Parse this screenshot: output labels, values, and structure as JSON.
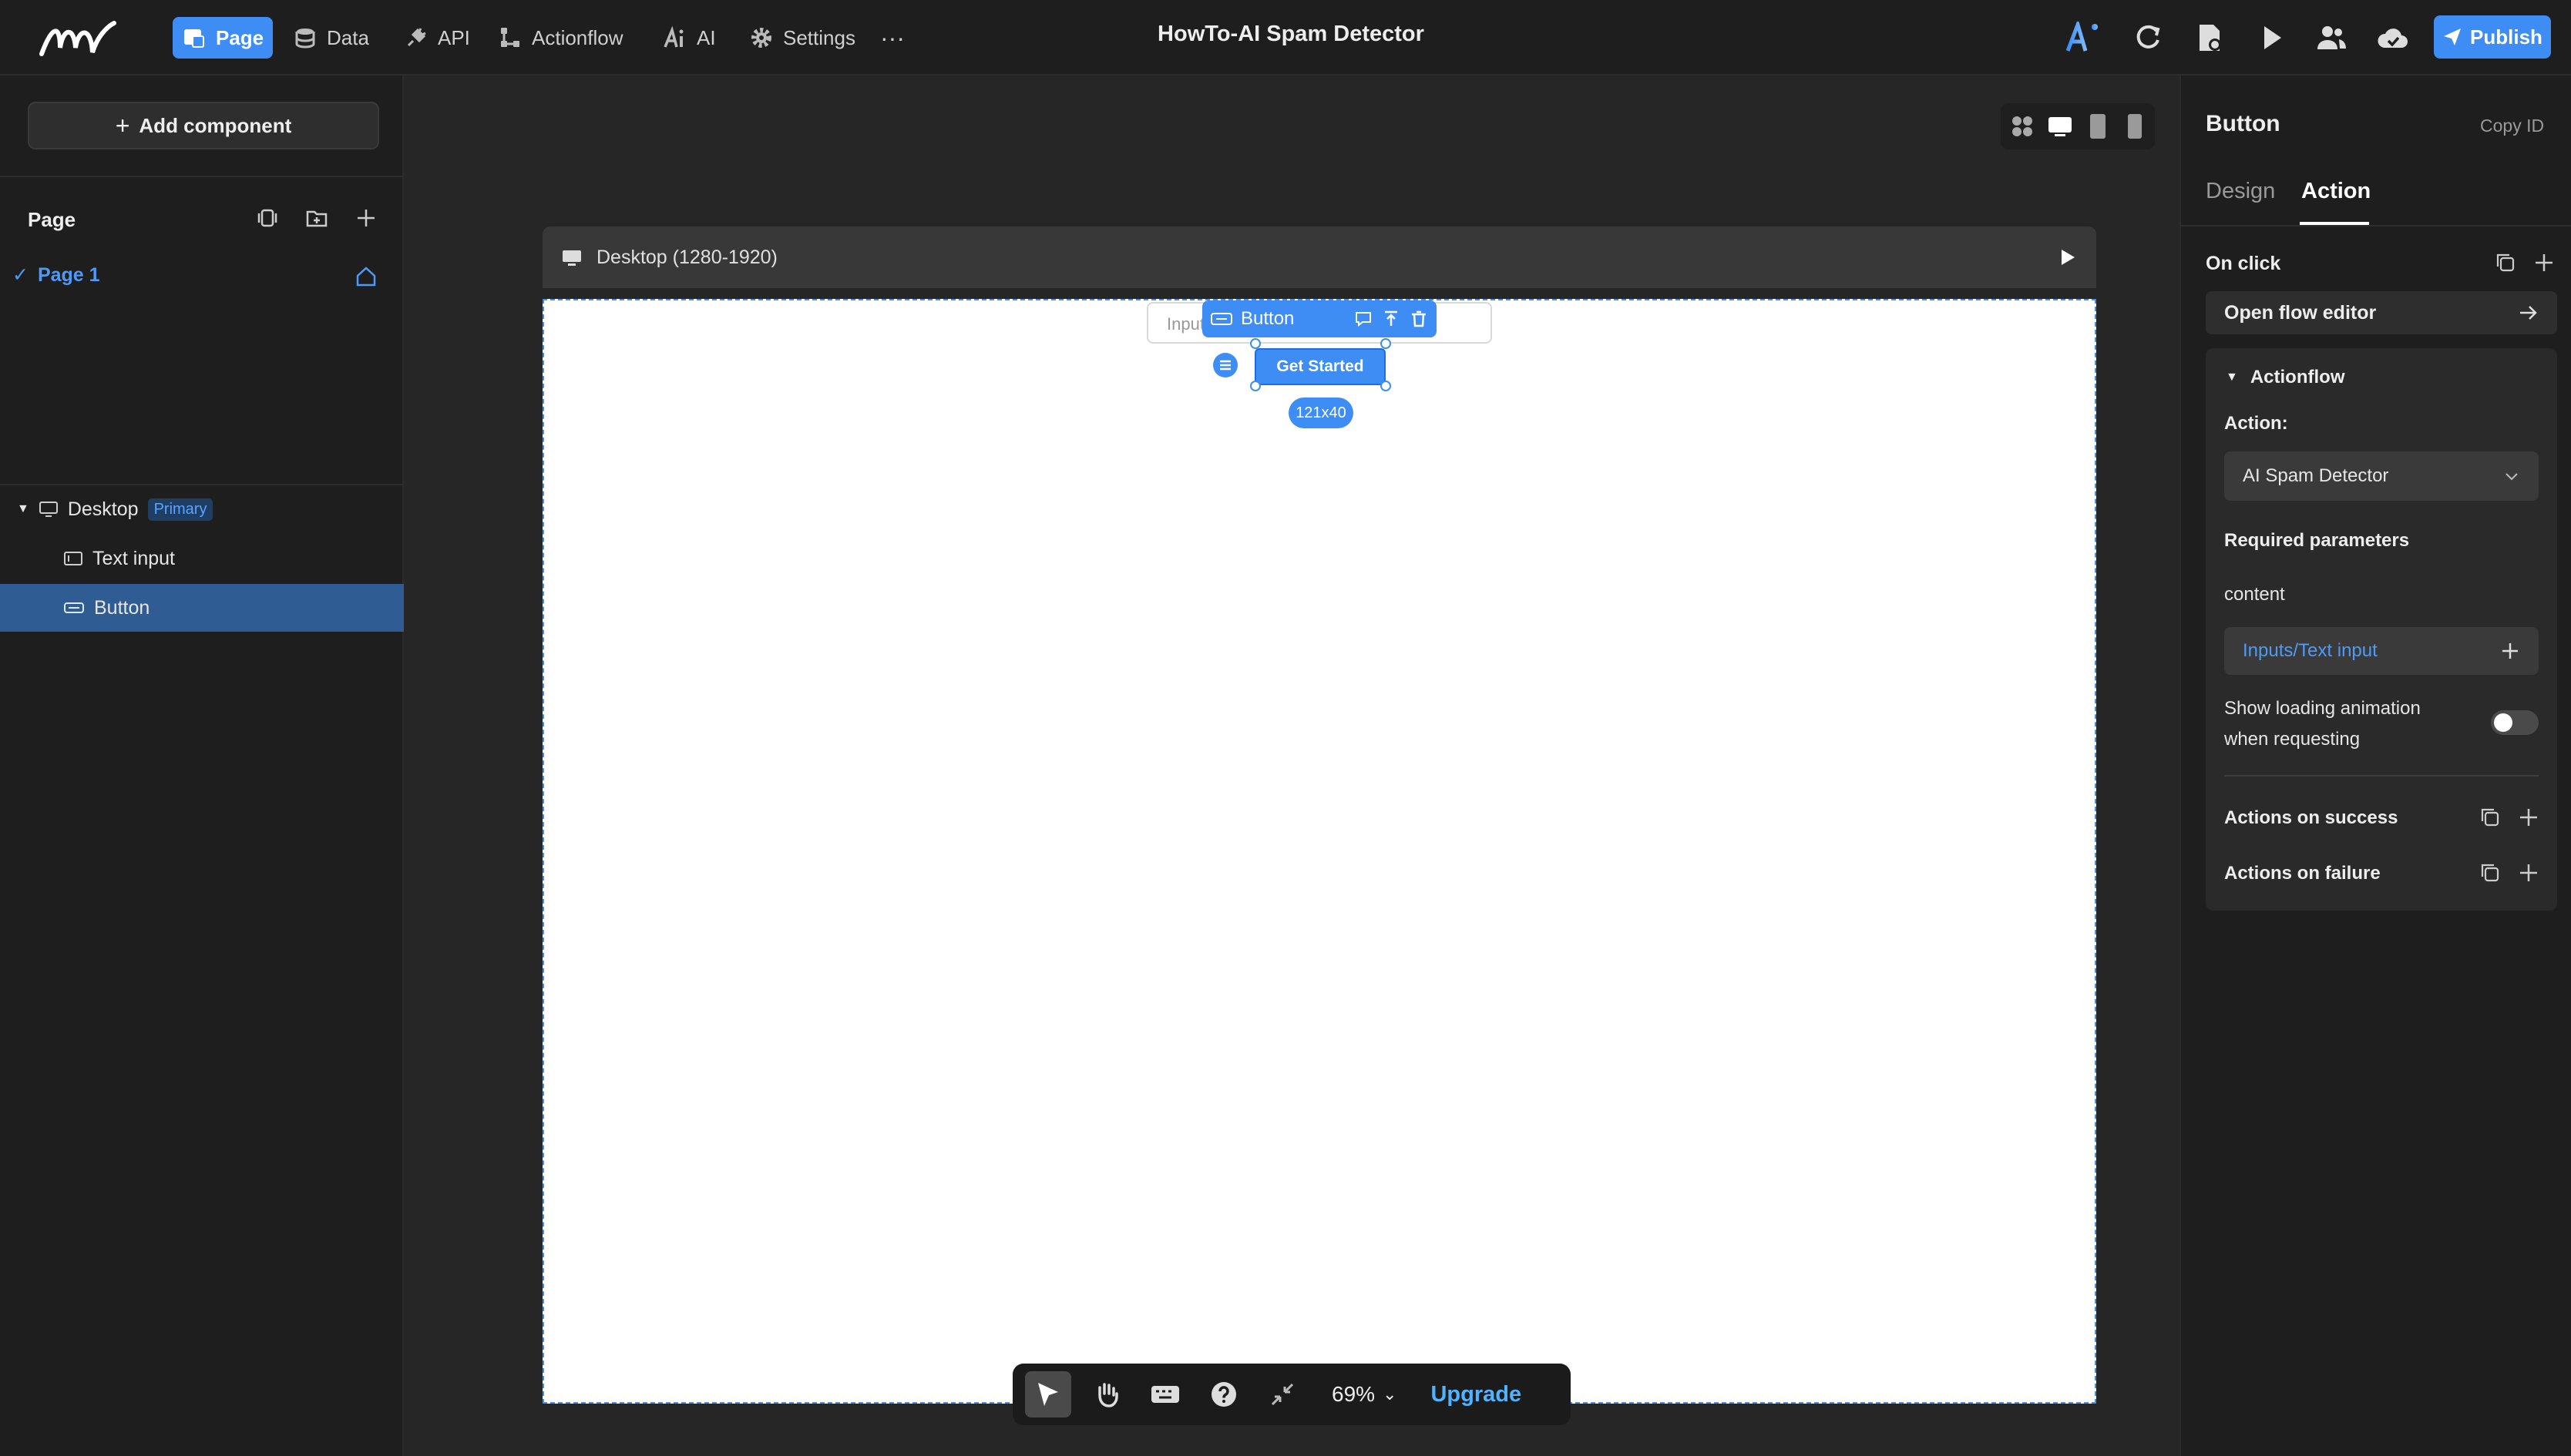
{
  "app": {
    "title": "HowTo-AI Spam Detector",
    "publish_label": "Publish"
  },
  "nav": {
    "items": [
      {
        "label": "Page",
        "icon": "page-icon",
        "active": true
      },
      {
        "label": "Data",
        "icon": "database-icon"
      },
      {
        "label": "API",
        "icon": "plug-icon"
      },
      {
        "label": "Actionflow",
        "icon": "flow-icon"
      },
      {
        "label": "AI",
        "icon": "ai-icon"
      },
      {
        "label": "Settings",
        "icon": "gear-icon"
      }
    ],
    "more": "···"
  },
  "left": {
    "add_component": "Add component",
    "page_section": "Page",
    "page_item": "Page 1",
    "tree": {
      "desktop": "Desktop",
      "desktop_badge": "Primary",
      "text_input": "Text input",
      "button": "Button"
    }
  },
  "canvas": {
    "device_label": "Desktop (1280-1920)",
    "input_placeholder": "Input",
    "toolbar_label": "Button",
    "button_text": "Get Started",
    "size_label": "121x40",
    "zoom": "69%",
    "upgrade": "Upgrade"
  },
  "right": {
    "title": "Button",
    "copy_id": "Copy ID",
    "tabs": [
      "Design",
      "Action"
    ],
    "active_tab": "Action",
    "on_click": "On click",
    "open_flow_editor": "Open flow editor",
    "actionflow": "Actionflow",
    "action_label": "Action:",
    "action_value": "AI Spam Detector",
    "required_params": "Required parameters",
    "param_name": "content",
    "param_value": "Inputs/Text input",
    "loading_label_1": "Show loading animation",
    "loading_label_2": "when requesting",
    "loading_enabled": false,
    "actions_success": "Actions on success",
    "actions_failure": "Actions on failure"
  },
  "colors": {
    "accent": "#3d8df5",
    "link": "#4e9af7",
    "selected_row": "#2f5d93",
    "upgrade": "#4fb3ff"
  }
}
